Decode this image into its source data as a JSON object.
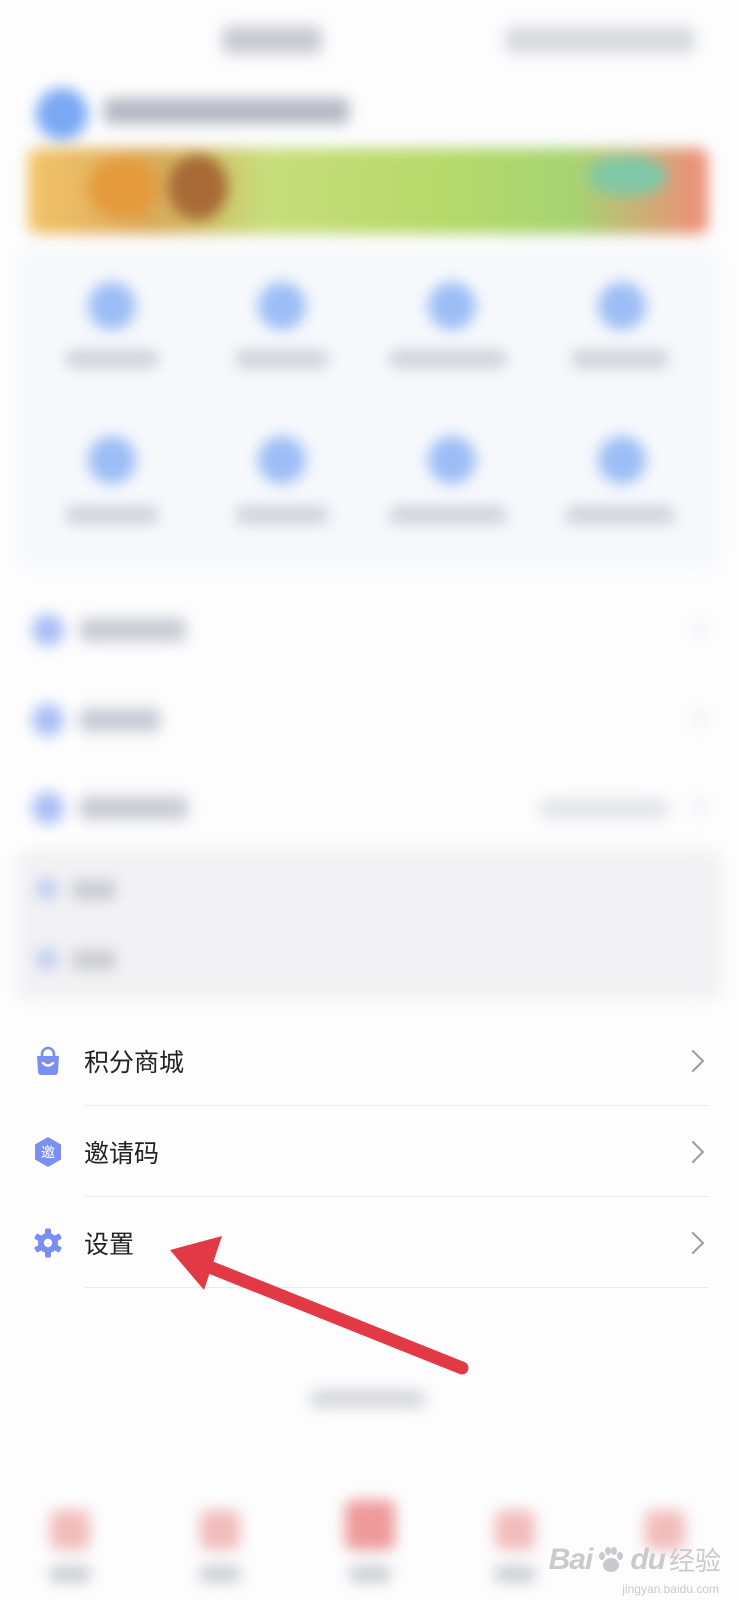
{
  "menu": {
    "items": [
      {
        "label": "积分商城",
        "icon": "shopping-bag-icon"
      },
      {
        "label": "邀请码",
        "icon": "invite-code-icon",
        "badge_char": "邀"
      },
      {
        "label": "设置",
        "icon": "gear-icon"
      }
    ]
  },
  "colors": {
    "icon_accent": "#7b8ff0",
    "annotation_arrow": "#e13a44",
    "text": "#222222",
    "chevron": "#9a9ca2"
  },
  "watermark": {
    "brand": "Bai",
    "brand_suffix": "du",
    "jingyan": "经验",
    "url": "jingyan.baidu.com"
  }
}
